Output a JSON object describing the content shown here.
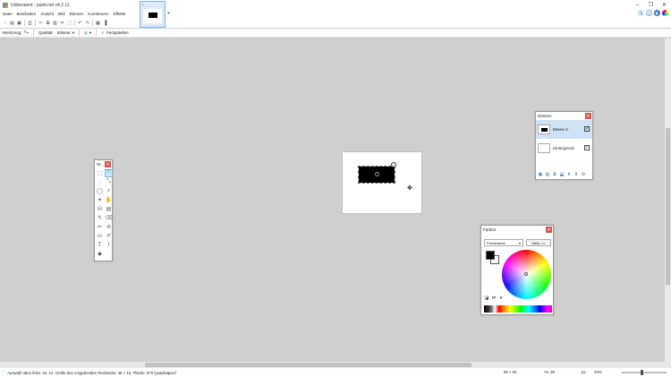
{
  "window": {
    "title": "Unbenannt - paint.net v4.2.11",
    "controls": [
      "–",
      "❐",
      "✕"
    ]
  },
  "menu": [
    "Datei",
    "Bearbeiten",
    "Ansicht",
    "Bild",
    "Ebenen",
    "Korrekturen",
    "Effekte"
  ],
  "toolbar2": {
    "tool_label": "Werkzeug:",
    "quality_label": "Qualität:",
    "quality_value": "Bilinear",
    "finish_label": "Fertigstellen"
  },
  "layers_panel": {
    "title": "Ebenen",
    "items": [
      {
        "name": "Ebene 2",
        "visible": true,
        "selected": true
      },
      {
        "name": "Hintergrund",
        "visible": true,
        "selected": false
      }
    ]
  },
  "tools_panel": {
    "title": "W..."
  },
  "colors_panel": {
    "title": "Farben",
    "select_value": "Primärfarbe",
    "more_label": "Mehr >>",
    "primary_color": "#000000",
    "secondary_color": "#ffffff"
  },
  "status": {
    "selection_text": "Auswahl oben links: 18, 14. Größe des umgebenden Rechtecks: 38 × 15. Fläche: 570 Quadratpixel",
    "image_size": "90 × 60",
    "cursor_pos": "73, 39",
    "unit": "px",
    "zoom": "29%"
  }
}
